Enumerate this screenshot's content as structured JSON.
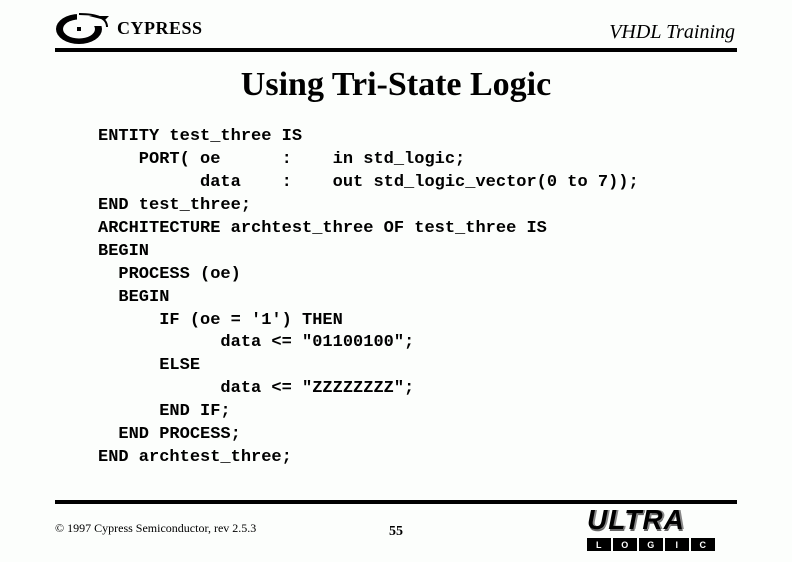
{
  "header": {
    "brand": "CYPRESS",
    "course": "VHDL Training"
  },
  "slide": {
    "title": "Using Tri-State Logic"
  },
  "code": {
    "l1": "ENTITY test_three IS",
    "l2": "    PORT( oe      :    in std_logic;",
    "l3": "          data    :    out std_logic_vector(0 to 7));",
    "l4": "END test_three;",
    "l5": "ARCHITECTURE archtest_three OF test_three IS",
    "l6": "BEGIN",
    "l7": "  PROCESS (oe)",
    "l8": "  BEGIN",
    "l9": "      IF (oe = '1') THEN",
    "l10": "            data <= \"01100100\";",
    "l11": "      ELSE",
    "l12": "            data <= \"ZZZZZZZZ\";",
    "l13": "      END IF;",
    "l14": "  END PROCESS;",
    "l15": "END archtest_three;"
  },
  "footer": {
    "copyright": "© 1997 Cypress Semiconductor, rev 2.5.3",
    "page": "55",
    "ultra": "ULTRA",
    "ultra_sub": [
      "L",
      "O",
      "G",
      "I",
      "C"
    ]
  }
}
